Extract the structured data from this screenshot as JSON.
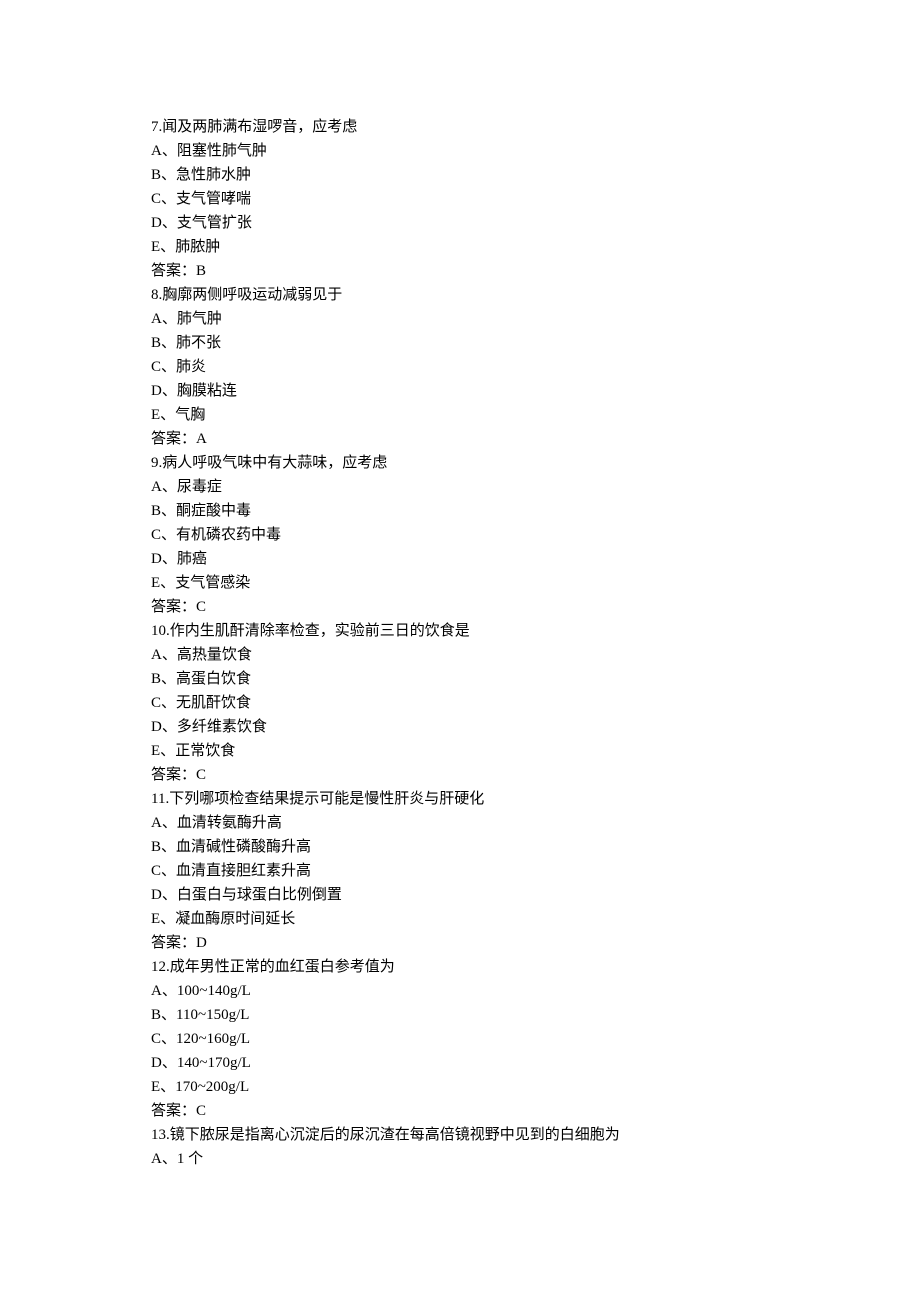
{
  "questions": [
    {
      "num": "7",
      "text": "闻及两肺满布湿啰音，应考虑",
      "options": [
        {
          "letter": "A",
          "text": "阻塞性肺气肿"
        },
        {
          "letter": "B",
          "text": "急性肺水肿"
        },
        {
          "letter": "C",
          "text": "支气管哮喘"
        },
        {
          "letter": "D",
          "text": "支气管扩张"
        },
        {
          "letter": "E",
          "text": "肺脓肿"
        }
      ],
      "answer_label": "答案：",
      "answer": "B"
    },
    {
      "num": "8",
      "text": "胸廓两侧呼吸运动减弱见于",
      "options": [
        {
          "letter": "A",
          "text": "肺气肿"
        },
        {
          "letter": "B",
          "text": "肺不张"
        },
        {
          "letter": "C",
          "text": "肺炎"
        },
        {
          "letter": "D",
          "text": "胸膜粘连"
        },
        {
          "letter": "E",
          "text": "气胸"
        }
      ],
      "answer_label": "答案：",
      "answer": "A"
    },
    {
      "num": "9",
      "text": "病人呼吸气味中有大蒜味，应考虑",
      "options": [
        {
          "letter": "A",
          "text": "尿毒症"
        },
        {
          "letter": "B",
          "text": "酮症酸中毒"
        },
        {
          "letter": "C",
          "text": "有机磷农药中毒"
        },
        {
          "letter": "D",
          "text": "肺癌"
        },
        {
          "letter": "E",
          "text": "支气管感染"
        }
      ],
      "answer_label": "答案：",
      "answer": "C"
    },
    {
      "num": "10",
      "text": "作内生肌酐清除率检查，实验前三日的饮食是",
      "options": [
        {
          "letter": "A",
          "text": "高热量饮食"
        },
        {
          "letter": "B",
          "text": "高蛋白饮食"
        },
        {
          "letter": "C",
          "text": "无肌酐饮食"
        },
        {
          "letter": "D",
          "text": "多纤维素饮食"
        },
        {
          "letter": "E",
          "text": "正常饮食"
        }
      ],
      "answer_label": "答案：",
      "answer": "C"
    },
    {
      "num": "11",
      "text": "下列哪项检查结果提示可能是慢性肝炎与肝硬化",
      "options": [
        {
          "letter": "A",
          "text": "血清转氨酶升高"
        },
        {
          "letter": "B",
          "text": "血清碱性磷酸酶升高"
        },
        {
          "letter": "C",
          "text": "血清直接胆红素升高"
        },
        {
          "letter": "D",
          "text": "白蛋白与球蛋白比例倒置"
        },
        {
          "letter": "E",
          "text": "凝血酶原时间延长"
        }
      ],
      "answer_label": "答案：",
      "answer": "D"
    },
    {
      "num": "12",
      "text": "成年男性正常的血红蛋白参考值为",
      "options": [
        {
          "letter": "A",
          "text": "100~140g/L"
        },
        {
          "letter": "B",
          "text": "110~150g/L"
        },
        {
          "letter": "C",
          "text": "120~160g/L"
        },
        {
          "letter": "D",
          "text": "140~170g/L"
        },
        {
          "letter": "E",
          "text": "170~200g/L"
        }
      ],
      "answer_label": "答案：",
      "answer": "C"
    },
    {
      "num": "13",
      "text": "镜下脓尿是指离心沉淀后的尿沉渣在每高倍镜视野中见到的白细胞为",
      "options": [
        {
          "letter": "A",
          "text": "1 个"
        }
      ],
      "answer_label": null,
      "answer": null
    }
  ],
  "sep": "、",
  "dot": "."
}
